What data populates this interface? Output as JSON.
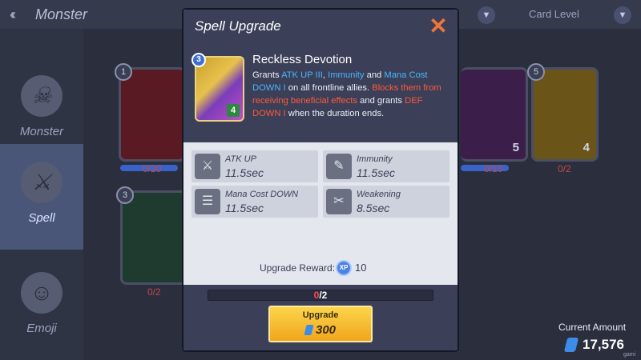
{
  "background": {
    "title": "Monster",
    "filter_label": "Card Level",
    "sidebar": [
      {
        "label": "Monster"
      },
      {
        "label": "Spell"
      },
      {
        "label": "Emoji"
      }
    ],
    "cards": [
      {
        "badge": "1",
        "count": "0/20"
      },
      {
        "badge": "",
        "num": "5"
      },
      {
        "badge": "5",
        "num": "4",
        "count": "0/2"
      },
      {
        "badge": "3",
        "count": "0/2"
      },
      {
        "count": "0/10"
      }
    ],
    "current_amount_label": "Current Amount",
    "current_amount": "17,576",
    "watermark": "gami"
  },
  "modal": {
    "title": "Spell Upgrade",
    "spell": {
      "name": "Reckless Devotion",
      "level": "3",
      "cost": "4",
      "desc": {
        "p1": "Grants ",
        "h1": "ATK UP III",
        "p2": ", ",
        "h2": "Immunity",
        "p3": " and ",
        "h3": "Mana Cost DOWN I",
        "p4": " on all frontline allies. ",
        "r1": "Blocks them from receiving beneficial effects",
        "p5": " and grants ",
        "r2": "DEF DOWN I",
        "p6": " when the duration ends."
      }
    },
    "effects": [
      {
        "name": "ATK UP",
        "value": "11.5sec",
        "icon": "atk-up-icon"
      },
      {
        "name": "Immunity",
        "value": "11.5sec",
        "icon": "immunity-icon"
      },
      {
        "name": "Mana Cost DOWN",
        "value": "11.5sec",
        "icon": "mana-cost-down-icon"
      },
      {
        "name": "Weakening",
        "value": "8.5sec",
        "icon": "weakening-icon"
      }
    ],
    "reward": {
      "label": "Upgrade Reward:",
      "value": "10",
      "icon": "reward-token-icon"
    },
    "progress": {
      "current": "0",
      "total": "2",
      "fraction": 0
    },
    "upgrade": {
      "label": "Upgrade",
      "cost": "300"
    }
  },
  "colors": {
    "header": "#3b3f58",
    "accent_orange": "#f0753a",
    "highlight_blue": "#4ab6ff",
    "highlight_red": "#ff5a3a",
    "button_gold": "#f0a51d"
  }
}
